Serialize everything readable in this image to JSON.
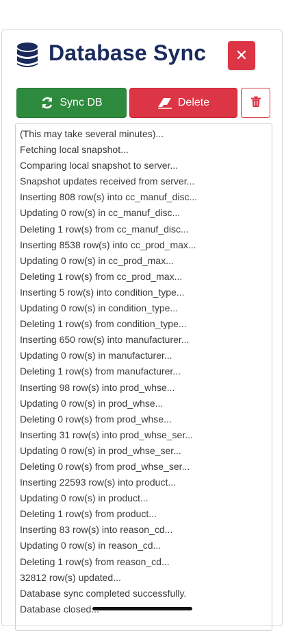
{
  "header": {
    "title": "Database Sync",
    "icon": "database-icon",
    "close_icon": "close-icon"
  },
  "actions": {
    "sync_label": "Sync DB",
    "sync_icon": "refresh-icon",
    "delete_label": "Delete",
    "delete_icon": "eraser-icon",
    "trash_icon": "trash-icon"
  },
  "colors": {
    "title": "#1a2a5c",
    "sync": "#2e8b3d",
    "danger": "#dc3545"
  },
  "log": [
    "(This may take several minutes)...",
    "Fetching local snapshot...",
    "Comparing local snapshot to server...",
    "Snapshot updates received from server...",
    "Inserting 808 row(s) into cc_manuf_disc...",
    "Updating 0 row(s) in cc_manuf_disc...",
    "Deleting 1 row(s) from cc_manuf_disc...",
    "Inserting 8538 row(s) into cc_prod_max...",
    "Updating 0 row(s) in cc_prod_max...",
    "Deleting 1 row(s) from cc_prod_max...",
    "Inserting 5 row(s) into condition_type...",
    "Updating 0 row(s) in condition_type...",
    "Deleting 1 row(s) from condition_type...",
    "Inserting 650 row(s) into manufacturer...",
    "Updating 0 row(s) in manufacturer...",
    "Deleting 1 row(s) from manufacturer...",
    "Inserting 98 row(s) into prod_whse...",
    "Updating 0 row(s) in prod_whse...",
    "Deleting 0 row(s) from prod_whse...",
    "Inserting 31 row(s) into prod_whse_ser...",
    "Updating 0 row(s) in prod_whse_ser...",
    "Deleting 0 row(s) from prod_whse_ser...",
    "Inserting 22593 row(s) into product...",
    "Updating 0 row(s) in product...",
    "Deleting 1 row(s) from product...",
    "Inserting 83 row(s) into reason_cd...",
    "Updating 0 row(s) in reason_cd...",
    "Deleting 1 row(s) from reason_cd...",
    "32812 row(s) updated...",
    "Database sync completed successfully.",
    "Database closed..."
  ]
}
